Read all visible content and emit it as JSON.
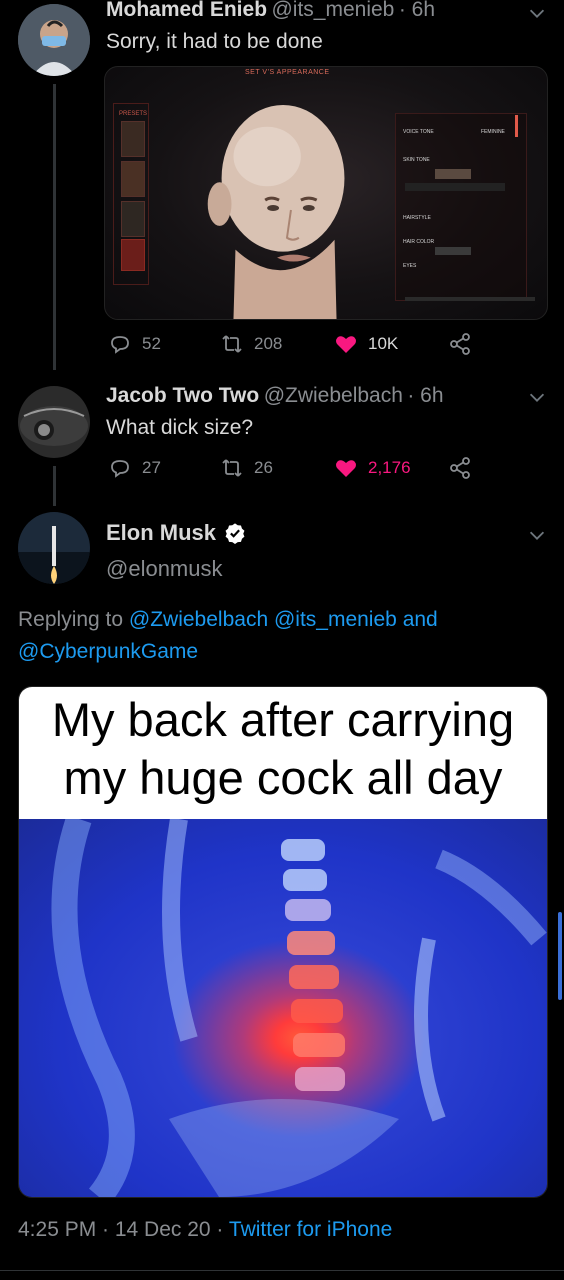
{
  "tweet1": {
    "name": "Mohamed Enieb",
    "handle": "@its_menieb",
    "time": "· 6h",
    "text": "Sorry, it had to be done",
    "image_header": "SET V'S APPEARANCE",
    "image_labels": [
      "PRESETS",
      "VOICE TONE",
      "SKIN TONE",
      "HAIRSTYLE",
      "HAIR COLOR",
      "EYES",
      "FEMININE"
    ],
    "replies": "52",
    "retweets": "208",
    "likes": "10K"
  },
  "tweet2": {
    "name": "Jacob Two Two",
    "handle": "@Zwiebelbach",
    "time": "· 6h",
    "text": "What dick size?",
    "replies": "27",
    "retweets": "26",
    "likes": "2,176"
  },
  "tweet3": {
    "name": "Elon Musk",
    "handle": "@elonmusk",
    "replying_prefix": "Replying to",
    "replying_handles": "@Zwiebelbach @its_menieb",
    "replying_and": "and",
    "replying_handle3": "@CyberpunkGame",
    "meme_caption": "My back after carrying my huge cock all day",
    "timestamp": "4:25 PM · 14 Dec 20 ·",
    "client": "Twitter for iPhone"
  },
  "colors": {
    "background": "#000000",
    "link": "#1d9bf0",
    "like": "#f91880",
    "muted": "#8a8d91",
    "verified": "#ffffff"
  },
  "icons": {
    "reply": "reply-icon",
    "retweet": "retweet-icon",
    "like": "heart-icon",
    "share": "share-icon",
    "more": "chevron-down-icon",
    "verified": "verified-badge-icon"
  }
}
